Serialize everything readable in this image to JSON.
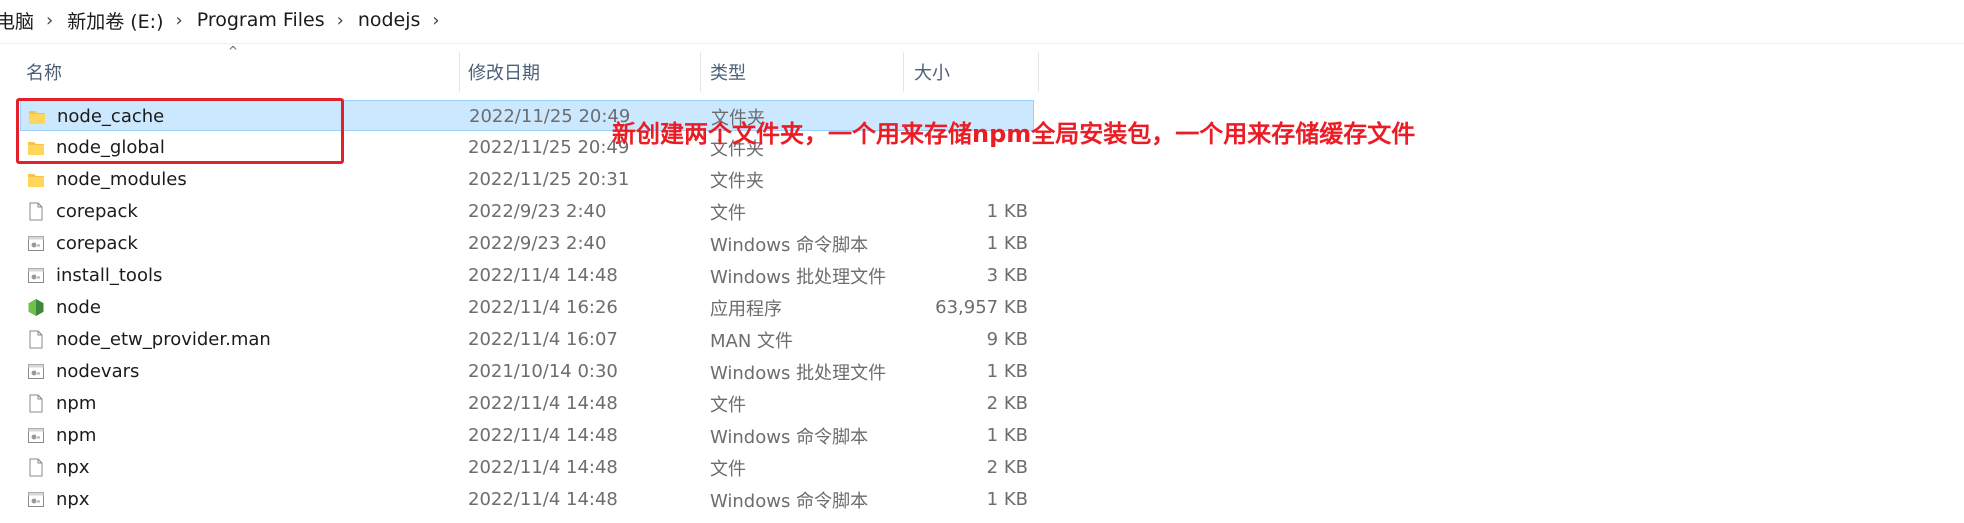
{
  "breadcrumb": [
    "电脑",
    "新加卷 (E:)",
    "Program Files",
    "nodejs"
  ],
  "columns": {
    "name": "名称",
    "date": "修改日期",
    "type": "类型",
    "size": "大小"
  },
  "annotation": "新创建两个文件夹，一个用来存储npm全局安装包，一个用来存储缓存文件",
  "colors": {
    "highlight_border": "#e1202a",
    "annotation": "#ec1c24",
    "selection": "#cce8ff",
    "folder": "#f6c445"
  },
  "files": [
    {
      "name": "node_cache",
      "date": "2022/11/25 20:49",
      "type": "文件夹",
      "size": "",
      "icon": "folder-icon",
      "selected": true
    },
    {
      "name": "node_global",
      "date": "2022/11/25 20:49",
      "type": "文件夹",
      "size": "",
      "icon": "folder-icon"
    },
    {
      "name": "node_modules",
      "date": "2022/11/25 20:31",
      "type": "文件夹",
      "size": "",
      "icon": "folder-icon"
    },
    {
      "name": "corepack",
      "date": "2022/9/23 2:40",
      "type": "文件",
      "size": "1 KB",
      "icon": "file-icon"
    },
    {
      "name": "corepack",
      "date": "2022/9/23 2:40",
      "type": "Windows 命令脚本",
      "size": "1 KB",
      "icon": "script-icon"
    },
    {
      "name": "install_tools",
      "date": "2022/11/4 14:48",
      "type": "Windows 批处理文件",
      "size": "3 KB",
      "icon": "script-icon"
    },
    {
      "name": "node",
      "date": "2022/11/4 16:26",
      "type": "应用程序",
      "size": "63,957 KB",
      "icon": "nodejs-icon"
    },
    {
      "name": "node_etw_provider.man",
      "date": "2022/11/4 16:07",
      "type": "MAN 文件",
      "size": "9 KB",
      "icon": "file-icon"
    },
    {
      "name": "nodevars",
      "date": "2021/10/14 0:30",
      "type": "Windows 批处理文件",
      "size": "1 KB",
      "icon": "script-icon"
    },
    {
      "name": "npm",
      "date": "2022/11/4 14:48",
      "type": "文件",
      "size": "2 KB",
      "icon": "file-icon"
    },
    {
      "name": "npm",
      "date": "2022/11/4 14:48",
      "type": "Windows 命令脚本",
      "size": "1 KB",
      "icon": "script-icon"
    },
    {
      "name": "npx",
      "date": "2022/11/4 14:48",
      "type": "文件",
      "size": "2 KB",
      "icon": "file-icon"
    },
    {
      "name": "npx",
      "date": "2022/11/4 14:48",
      "type": "Windows 命令脚本",
      "size": "1 KB",
      "icon": "script-icon"
    }
  ]
}
